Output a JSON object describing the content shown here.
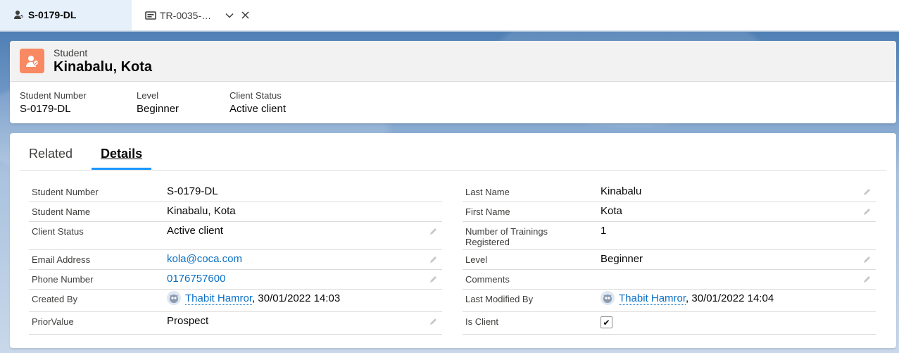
{
  "tabs": [
    {
      "label": "S-0179-DL",
      "icon": "student-icon"
    },
    {
      "label": "TR-0035-…",
      "icon": "training-record-icon"
    }
  ],
  "header": {
    "object_label": "Student",
    "record_name": "Kinabalu, Kota",
    "icon_color": "#f88962",
    "highlights": [
      {
        "label": "Student Number",
        "value": "S-0179-DL"
      },
      {
        "label": "Level",
        "value": "Beginner"
      },
      {
        "label": "Client Status",
        "value": "Active client"
      }
    ]
  },
  "detail_tabs": {
    "related": "Related",
    "details": "Details",
    "active": "Details"
  },
  "fields_left": [
    {
      "label": "Student Number",
      "value": "S-0179-DL",
      "editable": false
    },
    {
      "label": "Student Name",
      "value": "Kinabalu, Kota",
      "editable": false
    },
    {
      "label": "Client Status",
      "value": "Active client",
      "editable": true
    },
    {
      "label": "Email Address",
      "value": "kola@coca.com",
      "editable": true,
      "type": "link"
    },
    {
      "label": "Phone Number",
      "value": "0176757600",
      "editable": true,
      "type": "link"
    },
    {
      "label": "Created By",
      "user": "Thabit Hamror",
      "date": ", 30/01/2022 14:03",
      "editable": false
    },
    {
      "label": "PriorValue",
      "value": "Prospect",
      "editable": true
    }
  ],
  "fields_right": [
    {
      "label": "Last Name",
      "value": "Kinabalu",
      "editable": true
    },
    {
      "label": "First Name",
      "value": "Kota",
      "editable": true
    },
    {
      "label": "Number of Trainings Registered",
      "value": "1",
      "editable": false
    },
    {
      "label": "Level",
      "value": "Beginner",
      "editable": true
    },
    {
      "label": "Comments",
      "value": "",
      "editable": true
    },
    {
      "label": "Last Modified By",
      "user": "Thabit Hamror",
      "date": ", 30/01/2022 14:04",
      "editable": false
    },
    {
      "label": "Is Client",
      "checked": true,
      "check_glyph": "✔",
      "editable": false
    }
  ],
  "colors": {
    "link": "#0b6fc4",
    "active_tab_underline": "#1b96ff",
    "active_tab_bg": "#e6f0fa"
  }
}
